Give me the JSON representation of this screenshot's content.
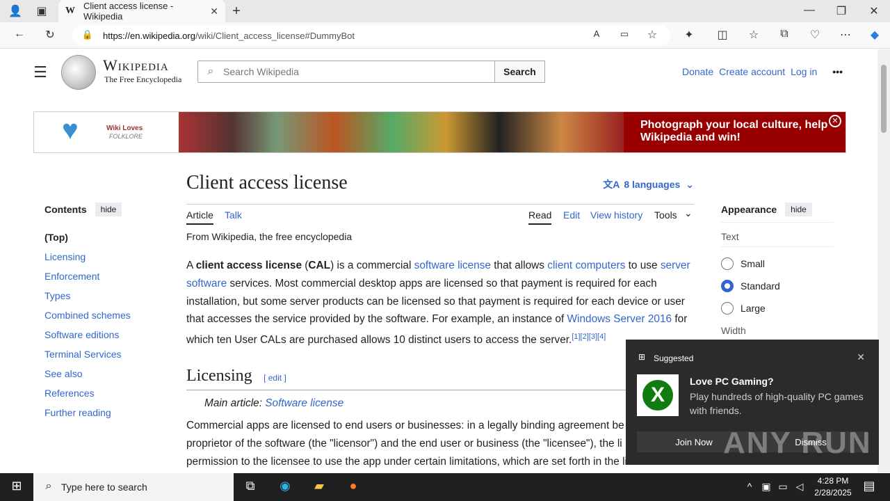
{
  "browser": {
    "tab_title": "Client access license - Wikipedia",
    "tab_favicon": "W",
    "url_host": "https://en.wikipedia.org",
    "url_path": "/wiki/Client_access_license#DummyBot"
  },
  "header": {
    "wordmark": "Wikipedia",
    "tagline": "The Free Encyclopedia",
    "search_placeholder": "Search Wikipedia",
    "search_button": "Search",
    "links": [
      "Donate",
      "Create account",
      "Log in"
    ],
    "more": "•••"
  },
  "banner": {
    "logo_line1": "Wiki Loves",
    "logo_line2": "FOLKLORE",
    "message": "Photograph your local culture, help Wikipedia and win!"
  },
  "toc": {
    "title": "Contents",
    "hide": "hide",
    "items": [
      "(Top)",
      "Licensing",
      "Enforcement",
      "Types",
      "Combined schemes",
      "Software editions",
      "Terminal Services",
      "See also",
      "References",
      "Further reading"
    ]
  },
  "article": {
    "title": "Client access license",
    "languages": "8 languages",
    "tabs": {
      "article": "Article",
      "talk": "Talk",
      "read": "Read",
      "edit": "Edit",
      "history": "View history",
      "tools": "Tools"
    },
    "from": "From Wikipedia, the free encyclopedia",
    "p1": {
      "a": "A ",
      "b1": "client access license",
      "c": " (",
      "b2": "CAL",
      "d": ") is a commercial ",
      "l1": "software license",
      "e": " that allows ",
      "l2": "client computers",
      "f": " to use ",
      "l3": "server software",
      "g": " services. Most commercial desktop apps are licensed so that payment is required for each installation, but some server products can be licensed so that payment is required for each device or user that accesses the service provided by the software. For example, an instance of ",
      "l4": "Windows Server 2016",
      "h": " for which ten User CALs are purchased allows 10 distinct users to access the server.",
      "refs": "[1][2][3][4]"
    },
    "licensing_heading": "Licensing",
    "edit_label": "[ edit ]",
    "main_article_prefix": "Main article: ",
    "main_article_link": "Software license",
    "p2_lines": [
      "Commercial apps are licensed to end users or businesses: in a legally binding agreement be",
      "proprietor of the software (the \"licensor\") and the end user or business (the \"licensee\"), the li",
      "permission to the licensee to use the app under certain limitations, which are set forth in the license"
    ]
  },
  "appearance": {
    "title": "Appearance",
    "hide": "hide",
    "text_label": "Text",
    "options": [
      "Small",
      "Standard",
      "Large"
    ],
    "selected": "Standard",
    "width_label": "Width"
  },
  "popup": {
    "label": "Suggested",
    "title": "Love PC Gaming?",
    "description": "Play hundreds of high-quality PC games with friends.",
    "join": "Join Now",
    "dismiss": "Dismiss",
    "watermark": "ANY RUN"
  },
  "taskbar": {
    "search_placeholder": "Type here to search",
    "time": "4:28 PM",
    "date": "2/28/2025"
  }
}
